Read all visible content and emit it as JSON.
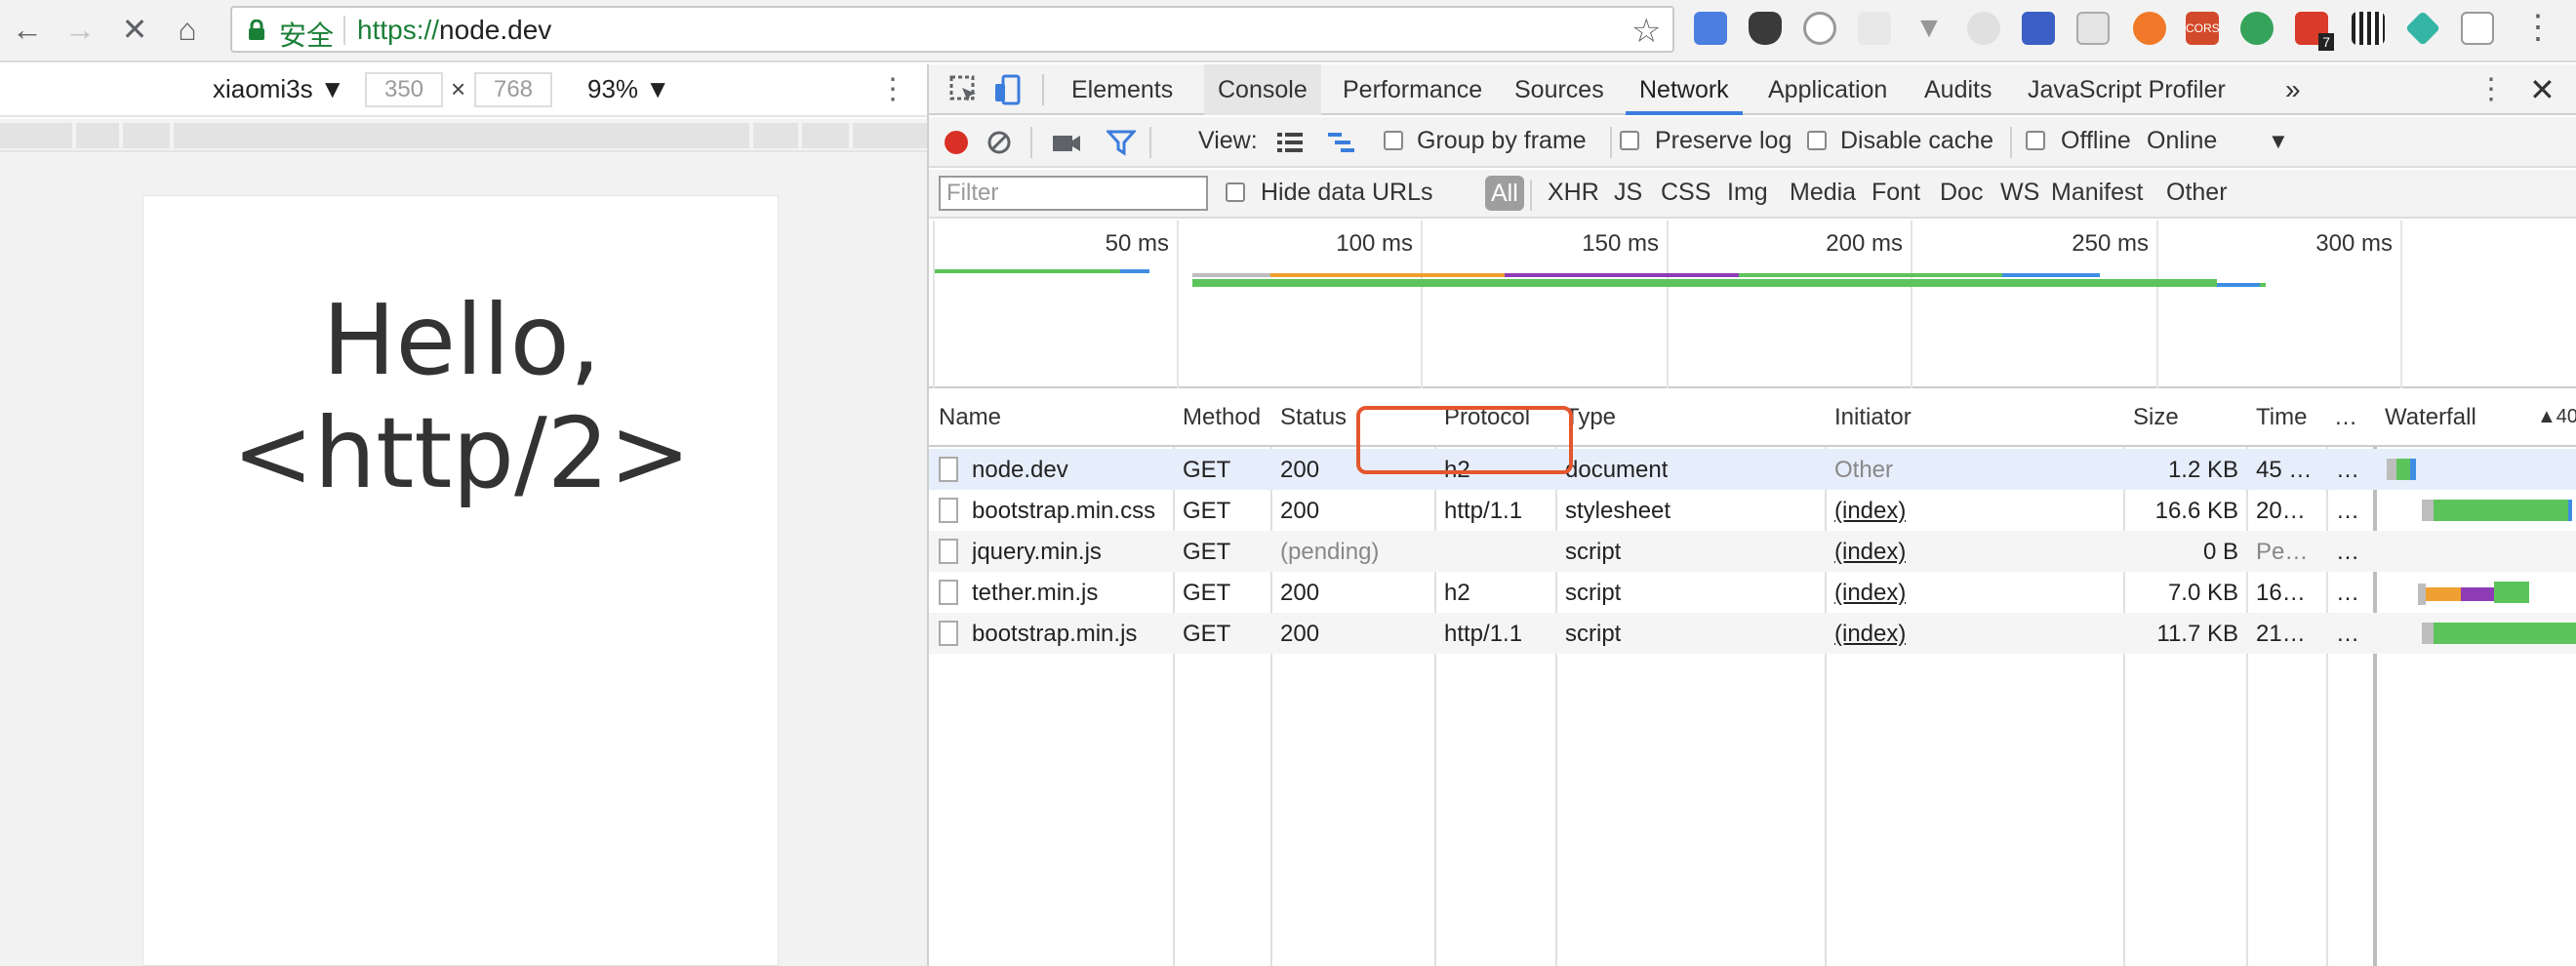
{
  "browser": {
    "secure_label": "安全",
    "url_protocol": "https://",
    "url_host": "node.dev",
    "extension_badge": "7"
  },
  "device": {
    "name": "xiaomi3s ▼",
    "width": "350",
    "height": "768",
    "dim_separator": "×",
    "zoom": "93% ▼"
  },
  "page": {
    "heading_line1": "Hello,",
    "heading_line2": "<http/2>"
  },
  "devtools": {
    "tabs": [
      "Elements",
      "Console",
      "Performance",
      "Sources",
      "Network",
      "Application",
      "Audits",
      "JavaScript Profiler"
    ],
    "active_tab": "Network",
    "more": "»",
    "toolbar": {
      "view_label": "View:",
      "group_by_frame": "Group by frame",
      "preserve_log": "Preserve log",
      "disable_cache": "Disable cache",
      "offline": "Offline",
      "throttle": "Online",
      "throttle_arrow": "▼"
    },
    "filter": {
      "placeholder": "Filter",
      "hide_data_urls": "Hide data URLs",
      "types": [
        "All",
        "XHR",
        "JS",
        "CSS",
        "Img",
        "Media",
        "Font",
        "Doc",
        "WS",
        "Manifest",
        "Other"
      ]
    },
    "overview_ticks": [
      "50 ms",
      "100 ms",
      "150 ms",
      "200 ms",
      "250 ms",
      "300 ms"
    ],
    "columns": [
      "Name",
      "Method",
      "Status",
      "Protocol",
      "Type",
      "Initiator",
      "Size",
      "Time",
      "…",
      "Waterfall",
      "▲40"
    ],
    "requests": [
      {
        "name": "node.dev",
        "method": "GET",
        "status": "200",
        "protocol": "h2",
        "type": "document",
        "initiator": "Other",
        "size": "1.2 KB",
        "time": "45 …",
        "extra": "…"
      },
      {
        "name": "bootstrap.min.css",
        "method": "GET",
        "status": "200",
        "protocol": "http/1.1",
        "type": "stylesheet",
        "initiator": "(index)",
        "size": "16.6 KB",
        "time": "20…",
        "extra": "…"
      },
      {
        "name": "jquery.min.js",
        "method": "GET",
        "status": "(pending)",
        "protocol": "",
        "type": "script",
        "initiator": "(index)",
        "size": "0 B",
        "time": "Pe…",
        "extra": "…"
      },
      {
        "name": "tether.min.js",
        "method": "GET",
        "status": "200",
        "protocol": "h2",
        "type": "script",
        "initiator": "(index)",
        "size": "7.0 KB",
        "time": "16…",
        "extra": "…"
      },
      {
        "name": "bootstrap.min.js",
        "method": "GET",
        "status": "200",
        "protocol": "http/1.1",
        "type": "script",
        "initiator": "(index)",
        "size": "11.7 KB",
        "time": "21…",
        "extra": "…"
      }
    ]
  },
  "colors": {
    "accent": "#3b7ddd",
    "secure_green": "#1a7f37",
    "record_red": "#d93025",
    "highlight": "#e4572e",
    "wf_green": "#5cc45a",
    "wf_orange": "#f0a030",
    "wf_purple": "#8e3cb5",
    "wf_blue": "#3d8ee3"
  }
}
